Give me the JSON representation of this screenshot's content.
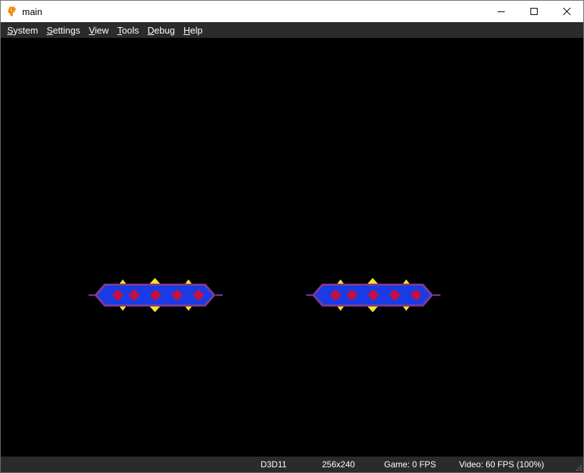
{
  "window": {
    "title": "main"
  },
  "menu": {
    "items": [
      {
        "first": "S",
        "rest": "ystem"
      },
      {
        "first": "S",
        "rest": "ettings"
      },
      {
        "first": "V",
        "rest": "iew"
      },
      {
        "first": "T",
        "rest": "ools"
      },
      {
        "first": "D",
        "rest": "ebug"
      },
      {
        "first": "H",
        "rest": "elp"
      }
    ]
  },
  "status": {
    "renderer": "D3D11",
    "resolution": "256x240",
    "game_fps": "Game: 0 FPS",
    "video_fps": "Video: 60 FPS (100%)"
  },
  "colors": {
    "menubar_bg": "#2b2b2b",
    "viewport_bg": "#000000",
    "sprite_body": "#1a3ae6",
    "sprite_outline": "#7a3a9a",
    "sprite_gem": "#c8103a",
    "sprite_spike": "#ffe020"
  },
  "icons": {
    "app": "app-icon",
    "minimize": "minimize-icon",
    "maximize": "maximize-icon",
    "close": "close-icon"
  }
}
